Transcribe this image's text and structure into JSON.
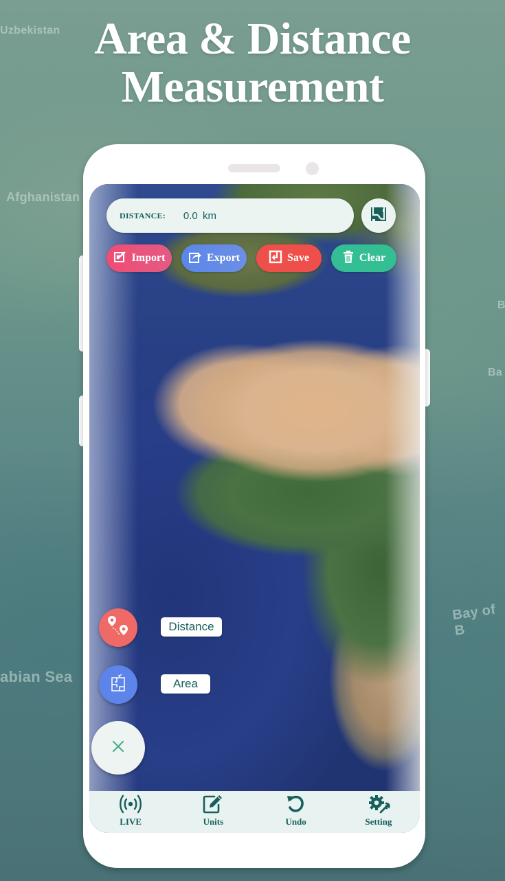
{
  "background_labels": {
    "uzbekistan": "Uzbekistan",
    "afghanistan": "Afghanistan",
    "arabian_sea": "abian Sea",
    "bay_of_bengal": "Bay of B",
    "ba_upper": "B",
    "ba_lower": "Ba"
  },
  "headline": {
    "line1": "Area & Distance",
    "line2": "Measurement"
  },
  "app": {
    "distance_bar": {
      "label": "DISTANCE:",
      "value": "0.0  km"
    },
    "map_type_icon": "map-layers-icon",
    "actions": [
      {
        "label": "Import",
        "icon": "import-icon",
        "color": "#ef4d74"
      },
      {
        "label": "Export",
        "icon": "export-icon",
        "color": "#5b86ea"
      },
      {
        "label": "Save",
        "icon": "save-icon",
        "color": "#ef4f4a"
      },
      {
        "label": "Clear",
        "icon": "trash-icon",
        "color": "#33bf93"
      }
    ],
    "fab_menu": {
      "distance_label": "Distance",
      "area_label": "Area",
      "distance_color": "#ef6a66",
      "area_color": "#5d84ea",
      "close_icon": "close-icon"
    },
    "bottom_nav": [
      {
        "label": "LIVE",
        "icon": "live-broadcast-icon"
      },
      {
        "label": "Units",
        "icon": "edit-units-icon"
      },
      {
        "label": "Undo",
        "icon": "undo-icon"
      },
      {
        "label": "Setting",
        "icon": "settings-icon"
      }
    ],
    "accent_color": "#165f5b"
  }
}
